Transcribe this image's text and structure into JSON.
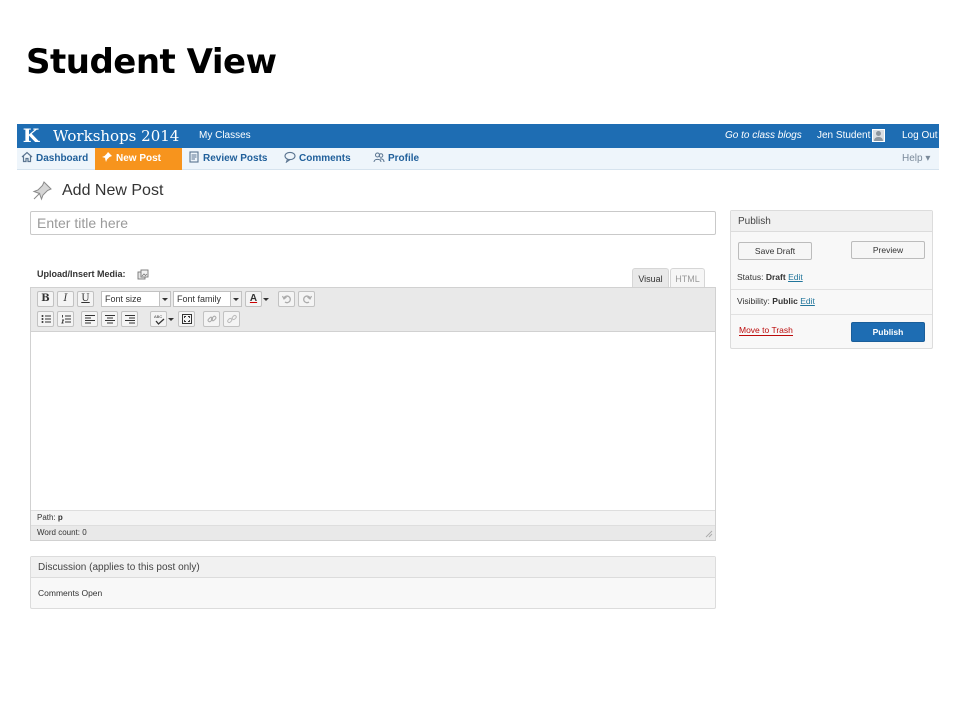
{
  "slide": {
    "title": "Student View"
  },
  "topbar": {
    "site_name": "Workshops 2014",
    "my_classes": "My Classes",
    "class_blogs": "Go to class blogs",
    "user_name": "Jen Student",
    "logout": "Log Out",
    "background": "#1e6db3"
  },
  "subnav": {
    "dashboard": "Dashboard",
    "new_post": "New Post",
    "review_posts": "Review Posts",
    "comments": "Comments",
    "profile": "Profile",
    "help": "Help ▾",
    "active_color": "#f7941d"
  },
  "page": {
    "heading": "Add New Post",
    "title_placeholder": "Enter title here",
    "media_label": "Upload/Insert Media:",
    "tabs": {
      "visual": "Visual",
      "html": "HTML"
    }
  },
  "toolbar": {
    "bold": "B",
    "italic": "I",
    "underline": "U",
    "font_size": "Font size",
    "font_family": "Font family",
    "text_color": "A",
    "icons": [
      "undo-icon",
      "redo-icon",
      "bullet-list-icon",
      "numbered-list-icon",
      "align-left-icon",
      "align-center-icon",
      "align-right-icon",
      "spellcheck-icon",
      "fullscreen-icon",
      "link-icon",
      "unlink-icon"
    ]
  },
  "editor": {
    "path_label": "Path:",
    "path_value": "p",
    "word_count": "Word count: 0"
  },
  "discussion": {
    "title": "Discussion (applies to this post only)",
    "status": "Comments Open"
  },
  "publish": {
    "title": "Publish",
    "save_draft": "Save Draft",
    "preview": "Preview",
    "status_label": "Status:",
    "status_value": "Draft",
    "visibility_label": "Visibility:",
    "visibility_value": "Public",
    "edit": "Edit",
    "move_to_trash": "Move to Trash",
    "publish_button": "Publish"
  }
}
